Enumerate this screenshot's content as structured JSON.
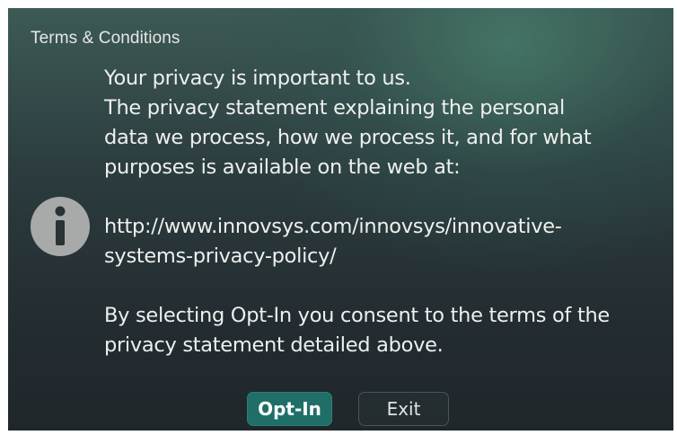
{
  "dialog": {
    "title": "Terms & Conditions",
    "icon": "info-icon",
    "lines": [
      "Your privacy is important to us.",
      "The privacy statement explaining the personal",
      "data we process, how we process it, and for what",
      "purposes is available on the web at:",
      "",
      "http://www.innovsys.com/innovsys/innovative-",
      "systems-privacy-policy/",
      "",
      "By selecting Opt-In you consent to the terms of the",
      "privacy statement detailed above."
    ],
    "buttons": {
      "opt_in": "Opt-In",
      "exit": "Exit"
    }
  },
  "colors": {
    "accent": "#1f6f68",
    "icon_gray": "#a7aaa8"
  }
}
